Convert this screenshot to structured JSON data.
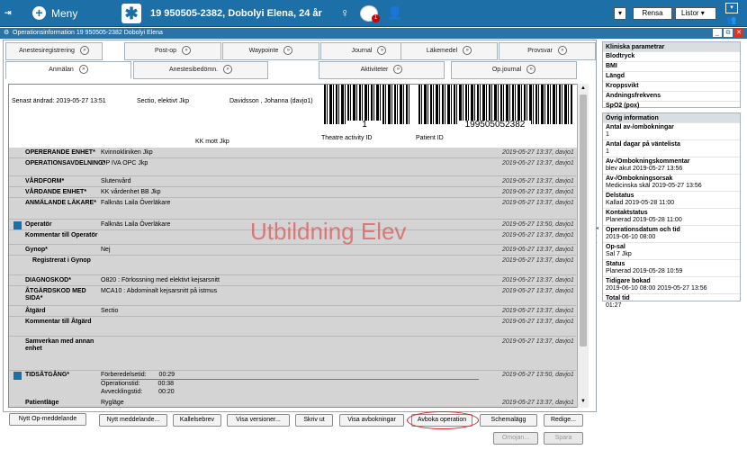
{
  "topbar": {
    "menu_label": "Meny",
    "patient": "19 950505-2382, Dobolyi Elena, 24 år",
    "gender_symbol": "♀",
    "alert_badge": "1",
    "buttons": {
      "rensa": "Rensa",
      "listor": "Listor"
    },
    "colors": {
      "bar": "#1d6fa8",
      "alert": "#cc0000"
    }
  },
  "window": {
    "title": "Operationsinformation 19 950505-2382 Dobolyi Elena"
  },
  "tabs_row1": [
    "Anestesiregistrering",
    "Post-op",
    "Waypointe",
    "Journal",
    "Läkemedel",
    "Provsvar"
  ],
  "tabs_row2": [
    "Anmälan",
    "Anestesibedömn.",
    "Aktiviteter",
    "Op.journal"
  ],
  "header": {
    "changed": "Senast ändrad: 2019-05-27 13:51",
    "procedure": "Sectio, elektivt Jkp",
    "user": "Davidsson , Johanna (davjo1)",
    "barcode1_number": "1",
    "barcode1_caption": "Theatre activity ID",
    "barcode2_number": "199505052382",
    "barcode2_caption": "Patient ID",
    "kk_label": "KK mott Jkp"
  },
  "watermark": "Utbildning Elev",
  "rows": [
    {
      "label": "OPERERANDE ENHET*",
      "value": "Kvinnokliniken Jkp",
      "ts": "2019-05-27 13:37, davjo1",
      "caps": true
    },
    {
      "label": "OPERATIONSAVDELNING*",
      "value": "OP IVA OPC Jkp",
      "ts": "2019-05-27 13:37, davjo1",
      "caps": true
    },
    {
      "label": "VÅRDFORM*",
      "value": "Slutenvård",
      "ts": "2019-05-27 13:37, davjo1",
      "caps": true
    },
    {
      "label": "VÅRDANDE ENHET*",
      "value": "KK vårdenhet BB Jkp",
      "ts": "2019-05-27 13:37, davjo1",
      "caps": true
    },
    {
      "label": "ANMÄLANDE LÄKARE*",
      "value": "Falknäs Laila Överläkare",
      "ts": "2019-05-27 13:37, davjo1",
      "caps": true
    },
    {
      "label": "Operatör",
      "value": "Falknäs Laila Överläkare",
      "ts": "2019-05-27 13:50, davjo1",
      "icon": true
    },
    {
      "label": "Kommentar till Operatör",
      "value": "",
      "ts": "2019-05-27 13:37, davjo1"
    },
    {
      "label": "Gynop*",
      "value": "Nej",
      "ts": "2019-05-27 13:37, davjo1"
    },
    {
      "label": "Registrerat i Gynop",
      "value": "",
      "ts": "2019-05-27 13:37, davjo1"
    },
    {
      "label": "DIAGNOSKOD*",
      "value": "O820 : Förlossning med elektivt kejsarsnitt",
      "ts": "2019-05-27 13:37, davjo1",
      "caps": true
    },
    {
      "label": "ÅTGÄRDSKOD MED SIDA*",
      "value": "MCA10 : Abdominalt kejsarsnitt på istmus",
      "ts": "2019-05-27 13:37, davjo1",
      "caps": true
    },
    {
      "label": "Åtgärd",
      "value": "Sectio",
      "ts": "2019-05-27 13:37, davjo1"
    },
    {
      "label": "Kommentar till Åtgärd",
      "value": "",
      "ts": "2019-05-27 13:37, davjo1"
    },
    {
      "label": "Samverkan med annan enhet",
      "value": "",
      "ts": "2019-05-27 13:37, davjo1"
    }
  ],
  "tidsatgang": {
    "label": "TIDSÅTGÅNG*",
    "ts": "2019-05-27 13:50, davjo1",
    "lines": [
      {
        "name": "Förberedelsetid:",
        "value": "00:29"
      },
      {
        "name": "Operationstid:",
        "value": "00:38"
      },
      {
        "name": "Avvecklingstid:",
        "value": "00:20"
      }
    ]
  },
  "patientlage": {
    "label": "Patientläge",
    "value": "Rygläge",
    "ts": "2019-05-27 13:37, davjo1"
  },
  "buttons": {
    "nytt_op": "Nytt Op-meddelande",
    "nytt_medd": "Nytt meddelande...",
    "kallelsebrev": "Kallelsebrev",
    "visa_versioner": "Visa versioner...",
    "skriv_ut": "Skriv ut",
    "visa_avbokningar": "Visa avbokningar",
    "avboka": "Avboka operation",
    "schemalagg": "Schemalägg",
    "redigera": "Redige...",
    "omojan": "Omojan...",
    "spara": "Spara"
  },
  "right_panel": {
    "kliniska_title": "Kliniska parametrar",
    "kliniska_items": [
      "Blodtryck",
      "BMI",
      "Längd",
      "Kroppsvikt",
      "Andningsfrekvens",
      "SpO2 (pox)"
    ],
    "ovrig_title": "Övrig information",
    "ovrig_items": [
      {
        "label": "Antal av-/ombokningar",
        "value": "1"
      },
      {
        "label": "Antal dagar på väntelista",
        "value": "1"
      },
      {
        "label": "Av-/Ombokningskommentar",
        "value": "blev akut 2019-05-27 13:56"
      },
      {
        "label": "Av-/Ombokningsorsak",
        "value": "Medicinska skäl 2019-05-27 13:56"
      },
      {
        "label": "Delstatus",
        "value": "Kallad 2019-05-28 11:00"
      },
      {
        "label": "Kontaktstatus",
        "value": "Planerad 2019-05-28 11:00"
      },
      {
        "label": "Operationsdatum och tid",
        "value": "2019-06-10 08:00"
      },
      {
        "label": "Op-sal",
        "value": "Sal 7 Jkp"
      },
      {
        "label": "Status",
        "value": "Planerad 2019-05-28 10:59"
      },
      {
        "label": "Tidigare bokad",
        "value": "2019-06-10 08:00 2019-05-27 13:56"
      },
      {
        "label": "Total tid",
        "value": "01:27"
      }
    ]
  }
}
